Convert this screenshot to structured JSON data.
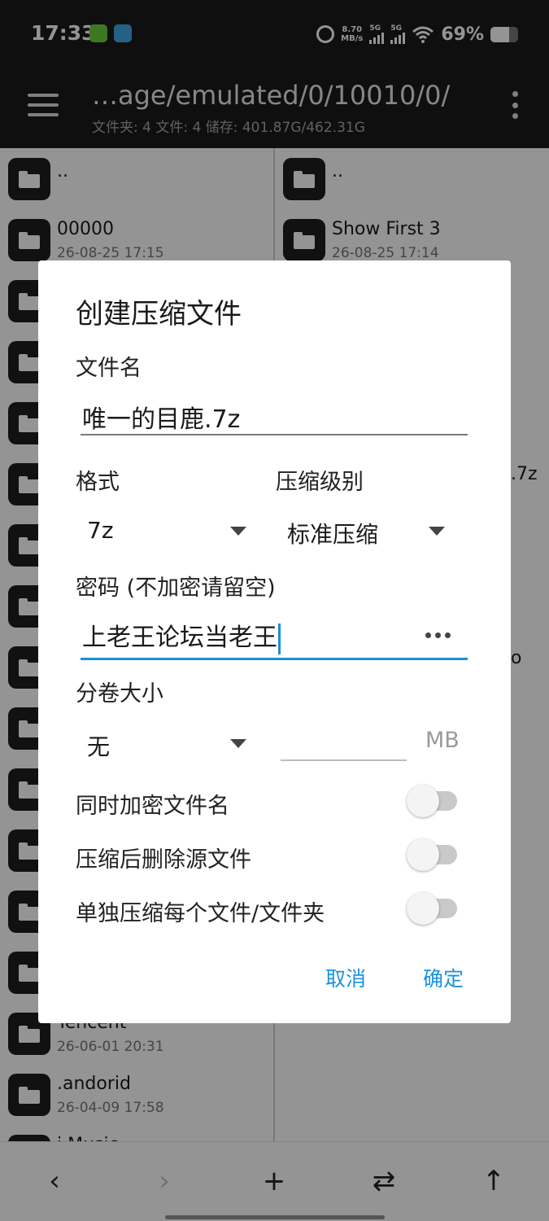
{
  "status_bar": {
    "time": "17:33",
    "net_speed_value": "8.70",
    "net_speed_unit": "MB/s",
    "sim1_label": "5G",
    "sim2_label": "5G",
    "battery_text": "69%",
    "battery_level": 0.69
  },
  "header": {
    "path": "…age/emulated/0/10010/0/",
    "info": "文件夹: 4  文件: 4  储存: 401.87G/462.31G"
  },
  "left_pane": {
    "items": [
      {
        "name": ".."
      },
      {
        "name": "00000",
        "date": "26-08-25 17:15"
      },
      {
        "name": "Tencent",
        "date": "26-06-01 20:31"
      },
      {
        "name": ".andorid",
        "date": "26-04-09 17:58"
      },
      {
        "name": "i Music"
      }
    ]
  },
  "right_pane": {
    "items": [
      {
        "name": ".."
      },
      {
        "name": "Show First 3",
        "date": "26-08-25 17:14"
      }
    ],
    "partial_1": ".7z",
    "partial_2": "o"
  },
  "dialog": {
    "title": "创建压缩文件",
    "filename_label": "文件名",
    "filename_value": "唯一的目鹿.7z",
    "format_label": "格式",
    "format_value": "7z",
    "level_label": "压缩级别",
    "level_value": "标准压缩",
    "password_label": "密码 (不加密请留空)",
    "password_value": "上老王论坛当老王",
    "split_label": "分卷大小",
    "split_value": "无",
    "split_unit": "MB",
    "switches": [
      {
        "label": "同时加密文件名",
        "on": false
      },
      {
        "label": "压缩后删除源文件",
        "on": false
      },
      {
        "label": "单独压缩每个文件/文件夹",
        "on": false
      }
    ],
    "cancel_label": "取消",
    "confirm_label": "确定"
  },
  "bottom_bar": {
    "back": "‹",
    "forward": "›",
    "add": "+",
    "swap": "⇄",
    "up": "↑"
  },
  "colors": {
    "accent": "#1d92d9",
    "header_bg": "#1b1b1b"
  }
}
